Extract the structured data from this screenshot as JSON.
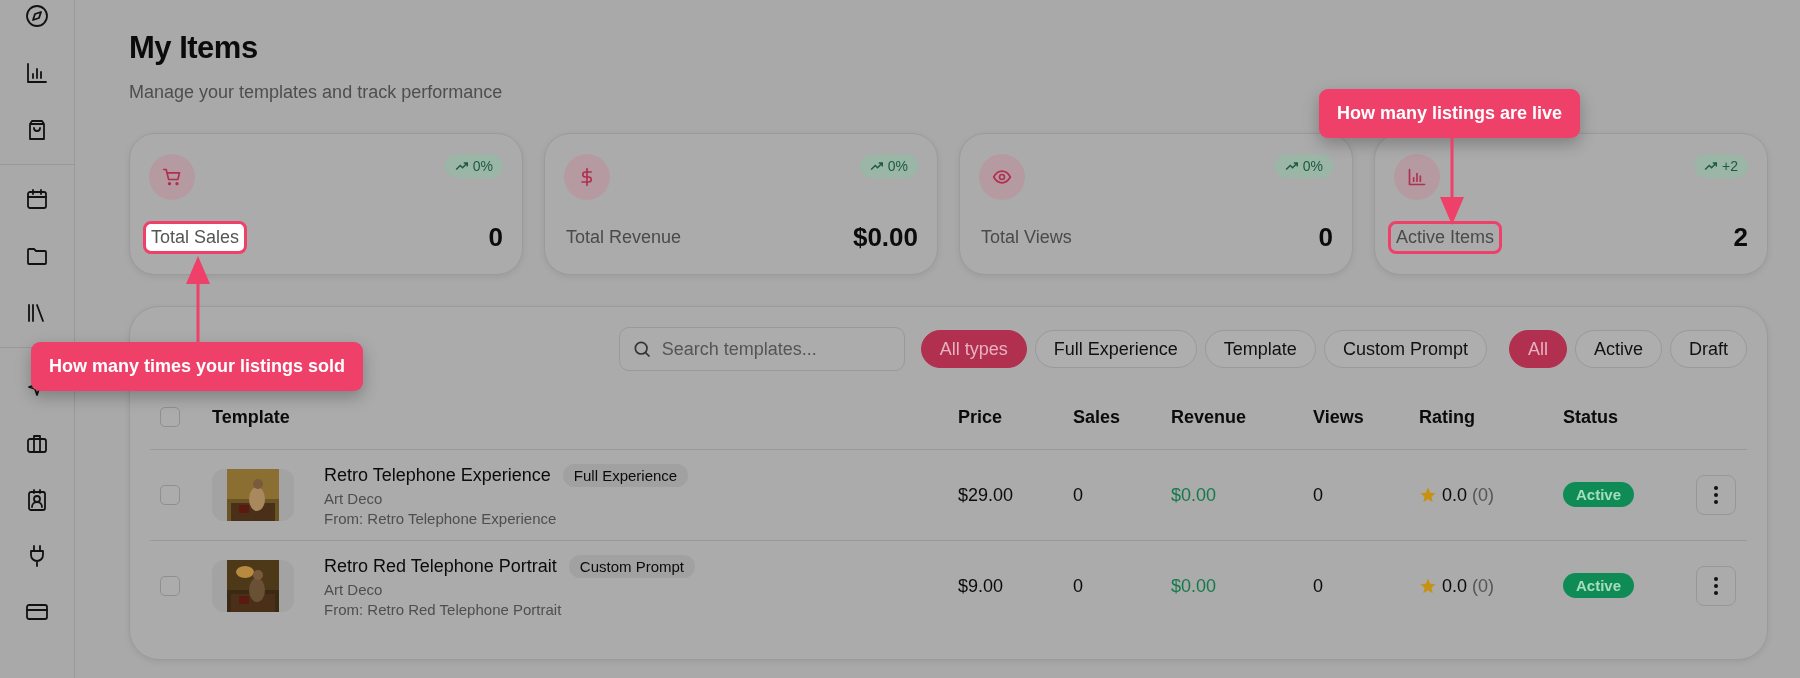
{
  "header": {
    "title": "My Items",
    "subtitle": "Manage your templates and track performance"
  },
  "stats": [
    {
      "label": "Total Sales",
      "value": "0",
      "trend": "0%",
      "highlighted": true,
      "spotlight": true
    },
    {
      "label": "Total Revenue",
      "value": "$0.00",
      "trend": "0%",
      "highlighted": false,
      "spotlight": false
    },
    {
      "label": "Total Views",
      "value": "0",
      "trend": "0%",
      "highlighted": false,
      "spotlight": false
    },
    {
      "label": "Active Items",
      "value": "2",
      "trend": "+2",
      "highlighted": true,
      "spotlight": false
    }
  ],
  "search": {
    "placeholder": "Search templates..."
  },
  "type_filters": [
    {
      "label": "All types",
      "selected": true
    },
    {
      "label": "Full Experience",
      "selected": false
    },
    {
      "label": "Template",
      "selected": false
    },
    {
      "label": "Custom Prompt",
      "selected": false
    }
  ],
  "status_filters": [
    {
      "label": "All",
      "selected": true
    },
    {
      "label": "Active",
      "selected": false
    },
    {
      "label": "Draft",
      "selected": false
    }
  ],
  "table": {
    "select_all_checked": false,
    "columns": [
      "Template",
      "Price",
      "Sales",
      "Revenue",
      "Views",
      "Rating",
      "Status"
    ],
    "rows": [
      {
        "checked": false,
        "name": "Retro Telephone Experience",
        "type": "Full Experience",
        "style": "Art Deco",
        "source": "From: Retro Telephone Experience",
        "price": "$29.00",
        "sales": "0",
        "revenue": "$0.00",
        "views": "0",
        "rating": "0.0",
        "rating_count": "(0)",
        "status": "Active"
      },
      {
        "checked": false,
        "name": "Retro Red Telephone Portrait",
        "type": "Custom Prompt",
        "style": "Art Deco",
        "source": "From: Retro Red Telephone Portrait",
        "price": "$9.00",
        "sales": "0",
        "revenue": "$0.00",
        "views": "0",
        "rating": "0.0",
        "rating_count": "(0)",
        "status": "Active"
      }
    ]
  },
  "tooltips": [
    "How many times your listings sold",
    "How many listings are live"
  ]
}
